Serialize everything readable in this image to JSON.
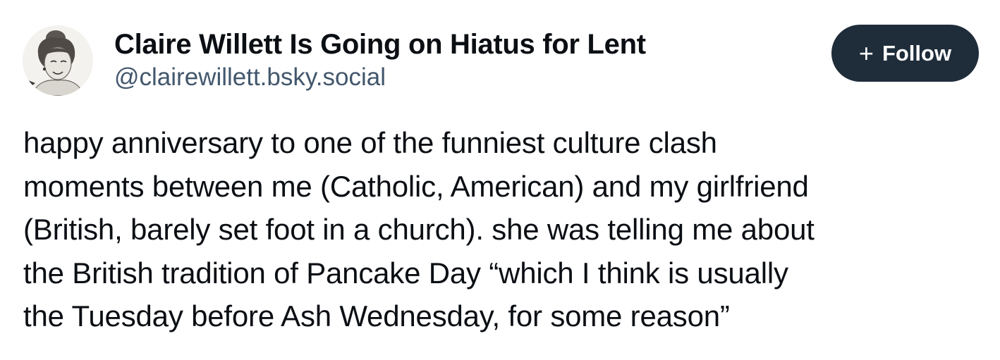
{
  "post": {
    "author": {
      "display_name": "Claire Willett Is Going on Hiatus for Lent",
      "handle": "@clairewillett.bsky.social",
      "avatar_icon": "avatar-illustration"
    },
    "follow_button": {
      "icon": "plus-icon",
      "icon_glyph": "+",
      "label": "Follow"
    },
    "text_lines": [
      "happy anniversary to one of the funniest culture clash",
      "moments between me (Catholic, American) and my girlfriend",
      "(British, barely set foot in a church). she was telling me about",
      "the British tradition of Pancake Day “which I think is usually",
      "the Tuesday before Ash Wednesday, for some reason”"
    ]
  },
  "colors": {
    "follow_button_bg": "#1f2c3a",
    "handle_text": "#42576c",
    "body_text": "#0b0f14"
  }
}
